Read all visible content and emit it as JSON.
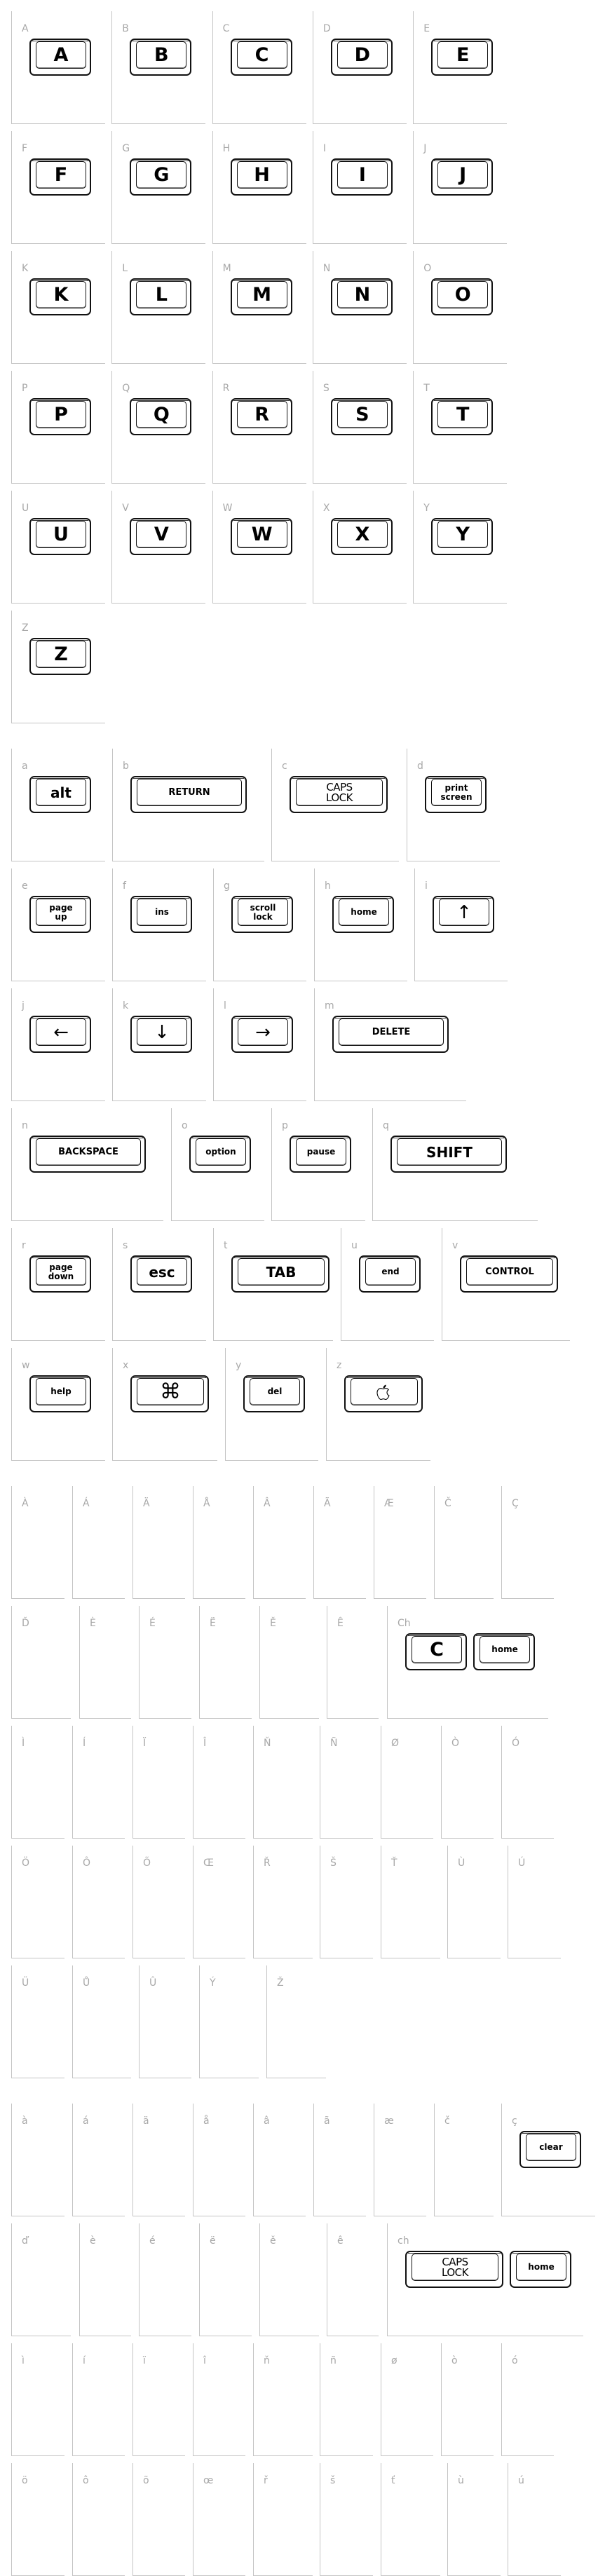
{
  "sections": {
    "uppercase": [
      {
        "label": "A",
        "keys": [
          {
            "text": "A",
            "icon": null
          }
        ]
      },
      {
        "label": "B",
        "keys": [
          {
            "text": "B",
            "icon": null
          }
        ]
      },
      {
        "label": "C",
        "keys": [
          {
            "text": "C",
            "icon": null
          }
        ]
      },
      {
        "label": "D",
        "keys": [
          {
            "text": "D",
            "icon": null
          }
        ]
      },
      {
        "label": "E",
        "keys": [
          {
            "text": "E",
            "icon": null
          }
        ]
      },
      {
        "label": "F",
        "keys": [
          {
            "text": "F",
            "icon": null
          }
        ]
      },
      {
        "label": "G",
        "keys": [
          {
            "text": "G",
            "icon": null
          }
        ]
      },
      {
        "label": "H",
        "keys": [
          {
            "text": "H",
            "icon": null
          }
        ]
      },
      {
        "label": "I",
        "keys": [
          {
            "text": "I",
            "icon": null
          }
        ]
      },
      {
        "label": "J",
        "keys": [
          {
            "text": "J",
            "icon": null
          }
        ]
      },
      {
        "label": "K",
        "keys": [
          {
            "text": "K",
            "icon": null
          }
        ]
      },
      {
        "label": "L",
        "keys": [
          {
            "text": "L",
            "icon": null
          }
        ]
      },
      {
        "label": "M",
        "keys": [
          {
            "text": "M",
            "icon": null
          }
        ]
      },
      {
        "label": "N",
        "keys": [
          {
            "text": "N",
            "icon": null
          }
        ]
      },
      {
        "label": "O",
        "keys": [
          {
            "text": "O",
            "icon": null
          }
        ]
      },
      {
        "label": "P",
        "keys": [
          {
            "text": "P",
            "icon": null
          }
        ]
      },
      {
        "label": "Q",
        "keys": [
          {
            "text": "Q",
            "icon": null
          }
        ]
      },
      {
        "label": "R",
        "keys": [
          {
            "text": "R",
            "icon": null
          }
        ]
      },
      {
        "label": "S",
        "keys": [
          {
            "text": "S",
            "icon": null
          }
        ]
      },
      {
        "label": "T",
        "keys": [
          {
            "text": "T",
            "icon": null
          }
        ]
      },
      {
        "label": "U",
        "keys": [
          {
            "text": "U",
            "icon": null
          }
        ]
      },
      {
        "label": "V",
        "keys": [
          {
            "text": "V",
            "icon": null
          }
        ]
      },
      {
        "label": "W",
        "keys": [
          {
            "text": "W",
            "icon": null
          }
        ]
      },
      {
        "label": "X",
        "keys": [
          {
            "text": "X",
            "icon": null
          }
        ]
      },
      {
        "label": "Y",
        "keys": [
          {
            "text": "Y",
            "icon": null
          }
        ]
      },
      {
        "label": "Z",
        "keys": [
          {
            "text": "Z",
            "icon": null
          }
        ]
      }
    ],
    "lowercase": [
      {
        "label": "a",
        "keys": [
          {
            "text": "alt",
            "icon": null
          }
        ]
      },
      {
        "label": "b",
        "keys": [
          {
            "text": "RETURN",
            "icon": null
          }
        ]
      },
      {
        "label": "c",
        "keys": [
          {
            "text": "CAPS\nLOCK",
            "icon": null
          }
        ]
      },
      {
        "label": "d",
        "keys": [
          {
            "text": "print\nscreen",
            "icon": null
          }
        ]
      },
      {
        "label": "e",
        "keys": [
          {
            "text": "page\nup",
            "icon": null
          }
        ]
      },
      {
        "label": "f",
        "keys": [
          {
            "text": "ins",
            "icon": null
          }
        ]
      },
      {
        "label": "g",
        "keys": [
          {
            "text": "scroll\nlock",
            "icon": null
          }
        ]
      },
      {
        "label": "h",
        "keys": [
          {
            "text": "home",
            "icon": null
          }
        ]
      },
      {
        "label": "i",
        "keys": [
          {
            "text": "↑",
            "icon": "arrow-up-icon"
          }
        ]
      },
      {
        "label": "j",
        "keys": [
          {
            "text": "←",
            "icon": "arrow-left-icon"
          }
        ]
      },
      {
        "label": "k",
        "keys": [
          {
            "text": "↓",
            "icon": "arrow-down-icon"
          }
        ]
      },
      {
        "label": "l",
        "keys": [
          {
            "text": "→",
            "icon": "arrow-right-icon"
          }
        ]
      },
      {
        "label": "m",
        "keys": [
          {
            "text": "DELETE",
            "icon": null
          }
        ]
      },
      {
        "label": "n",
        "keys": [
          {
            "text": "BACKSPACE",
            "icon": null
          }
        ]
      },
      {
        "label": "o",
        "keys": [
          {
            "text": "option",
            "icon": null
          }
        ]
      },
      {
        "label": "p",
        "keys": [
          {
            "text": "pause",
            "icon": null
          }
        ]
      },
      {
        "label": "q",
        "keys": [
          {
            "text": "SHIFT",
            "icon": null
          }
        ]
      },
      {
        "label": "r",
        "keys": [
          {
            "text": "page\ndown",
            "icon": null
          }
        ]
      },
      {
        "label": "s",
        "keys": [
          {
            "text": "esc",
            "icon": null
          }
        ]
      },
      {
        "label": "t",
        "keys": [
          {
            "text": "TAB",
            "icon": null
          }
        ]
      },
      {
        "label": "u",
        "keys": [
          {
            "text": "end",
            "icon": null
          }
        ]
      },
      {
        "label": "v",
        "keys": [
          {
            "text": "CONTROL",
            "icon": null
          }
        ]
      },
      {
        "label": "w",
        "keys": [
          {
            "text": "help",
            "icon": null
          }
        ]
      },
      {
        "label": "x",
        "keys": [
          {
            "text": "⌘",
            "icon": "command-icon"
          }
        ]
      },
      {
        "label": "y",
        "keys": [
          {
            "text": "del",
            "icon": null
          }
        ]
      },
      {
        "label": "z",
        "keys": [
          {
            "text": "",
            "icon": "apple-logo-icon"
          }
        ]
      }
    ],
    "accented_upper": [
      {
        "label": "À",
        "keys": []
      },
      {
        "label": "Á",
        "keys": []
      },
      {
        "label": "Ä",
        "keys": []
      },
      {
        "label": "Å",
        "keys": []
      },
      {
        "label": "Â",
        "keys": []
      },
      {
        "label": "Ã",
        "keys": []
      },
      {
        "label": "Æ",
        "keys": []
      },
      {
        "label": "Č",
        "keys": []
      },
      {
        "label": "Ç",
        "keys": []
      },
      {
        "label": "Ď",
        "keys": []
      },
      {
        "label": "È",
        "keys": []
      },
      {
        "label": "É",
        "keys": []
      },
      {
        "label": "Ë",
        "keys": []
      },
      {
        "label": "Ě",
        "keys": []
      },
      {
        "label": "Ê",
        "keys": []
      },
      {
        "label": "Ch",
        "keys": [
          {
            "text": "C",
            "icon": null
          },
          {
            "text": "home",
            "icon": null
          }
        ]
      },
      {
        "label": "Ì",
        "keys": []
      },
      {
        "label": "Í",
        "keys": []
      },
      {
        "label": "Ï",
        "keys": []
      },
      {
        "label": "Î",
        "keys": []
      },
      {
        "label": "Ň",
        "keys": []
      },
      {
        "label": "Ñ",
        "keys": []
      },
      {
        "label": "Ø",
        "keys": []
      },
      {
        "label": "Ò",
        "keys": []
      },
      {
        "label": "Ó",
        "keys": []
      },
      {
        "label": "Ö",
        "keys": []
      },
      {
        "label": "Ô",
        "keys": []
      },
      {
        "label": "Õ",
        "keys": []
      },
      {
        "label": "Œ",
        "keys": []
      },
      {
        "label": "Ř",
        "keys": []
      },
      {
        "label": "Š",
        "keys": []
      },
      {
        "label": "Ť",
        "keys": []
      },
      {
        "label": "Ù",
        "keys": []
      },
      {
        "label": "Ú",
        "keys": []
      },
      {
        "label": "Ü",
        "keys": []
      },
      {
        "label": "Ů",
        "keys": []
      },
      {
        "label": "Û",
        "keys": []
      },
      {
        "label": "Ý",
        "keys": []
      },
      {
        "label": "Ž",
        "keys": []
      }
    ],
    "accented_lower": [
      {
        "label": "à",
        "keys": []
      },
      {
        "label": "á",
        "keys": []
      },
      {
        "label": "ä",
        "keys": []
      },
      {
        "label": "å",
        "keys": []
      },
      {
        "label": "â",
        "keys": []
      },
      {
        "label": "ã",
        "keys": []
      },
      {
        "label": "æ",
        "keys": []
      },
      {
        "label": "č",
        "keys": []
      },
      {
        "label": "ç",
        "keys": [
          {
            "text": "clear",
            "icon": null
          }
        ]
      },
      {
        "label": "ď",
        "keys": []
      },
      {
        "label": "è",
        "keys": []
      },
      {
        "label": "é",
        "keys": []
      },
      {
        "label": "ë",
        "keys": []
      },
      {
        "label": "ě",
        "keys": []
      },
      {
        "label": "ê",
        "keys": []
      },
      {
        "label": "ch",
        "keys": [
          {
            "text": "CAPS\nLOCK",
            "icon": null
          },
          {
            "text": "home",
            "icon": null
          }
        ]
      },
      {
        "label": "ì",
        "keys": []
      },
      {
        "label": "í",
        "keys": []
      },
      {
        "label": "ï",
        "keys": []
      },
      {
        "label": "î",
        "keys": []
      },
      {
        "label": "ň",
        "keys": []
      },
      {
        "label": "ñ",
        "keys": []
      },
      {
        "label": "ø",
        "keys": []
      },
      {
        "label": "ò",
        "keys": []
      },
      {
        "label": "ó",
        "keys": []
      },
      {
        "label": "ö",
        "keys": []
      },
      {
        "label": "ô",
        "keys": []
      },
      {
        "label": "õ",
        "keys": []
      },
      {
        "label": "œ",
        "keys": []
      },
      {
        "label": "ř",
        "keys": []
      },
      {
        "label": "š",
        "keys": []
      },
      {
        "label": "ť",
        "keys": []
      },
      {
        "label": "ù",
        "keys": []
      },
      {
        "label": "ú",
        "keys": []
      }
    ]
  }
}
